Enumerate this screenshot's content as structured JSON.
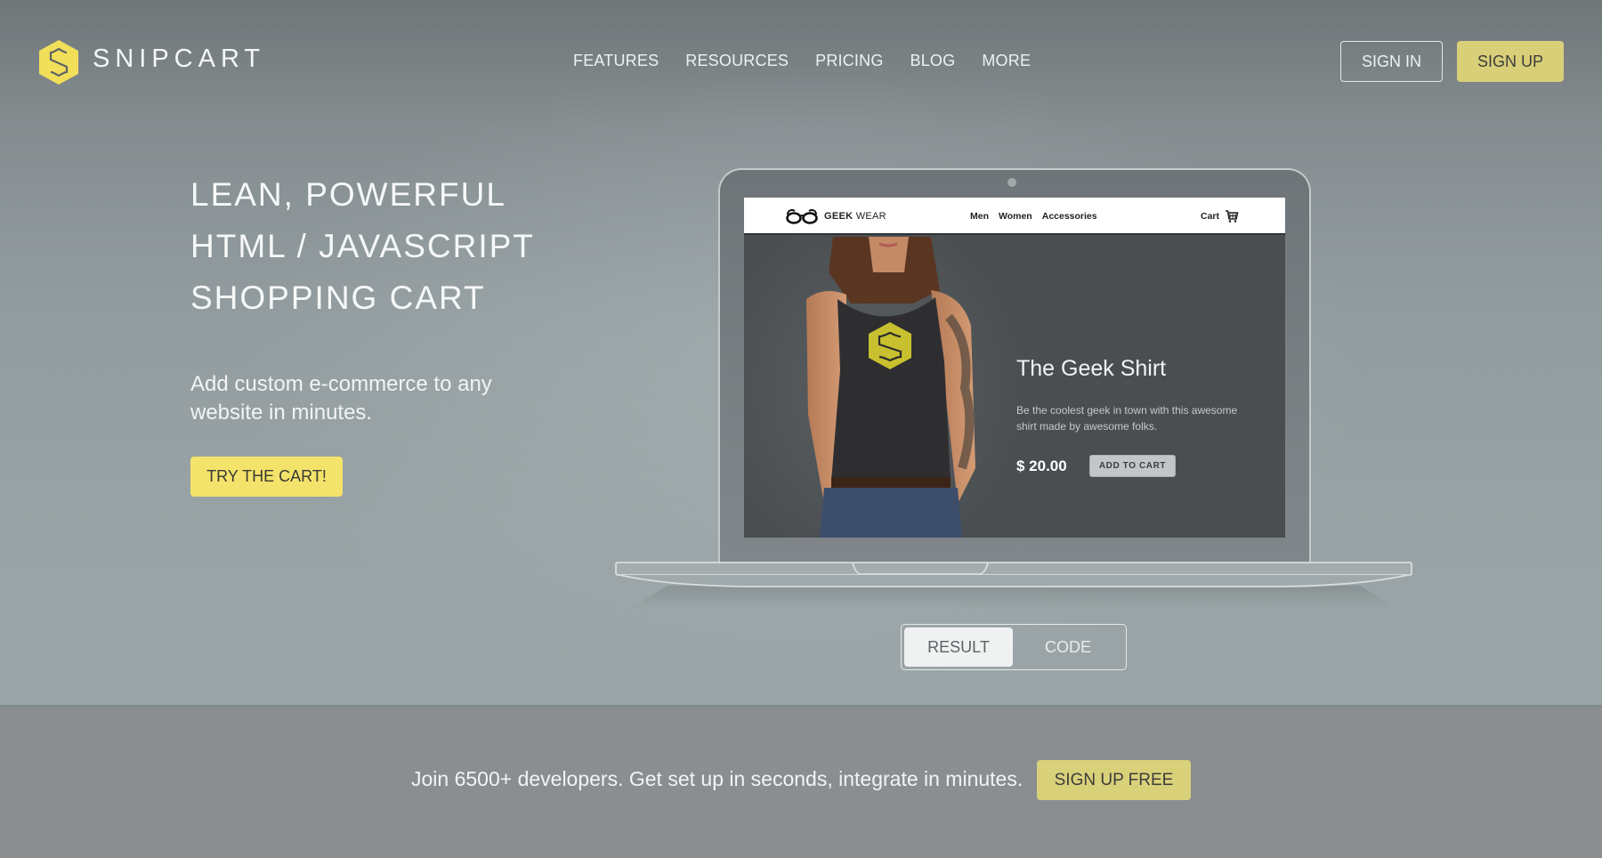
{
  "header": {
    "brand": "SNIPCART",
    "nav": [
      "FEATURES",
      "RESOURCES",
      "PRICING",
      "BLOG",
      "MORE"
    ],
    "sign_in": "SIGN IN",
    "sign_up": "SIGN UP"
  },
  "hero": {
    "headline": [
      "LEAN, POWERFUL",
      "HTML / JAVASCRIPT",
      "SHOPPING CART"
    ],
    "subline": "Add custom e-commerce to any website in minutes.",
    "cta": "TRY THE CART!"
  },
  "demo": {
    "site": {
      "brand_bold": "GEEK",
      "brand_rest": " WEAR",
      "links": [
        "Men",
        "Women",
        "Accessories"
      ],
      "cart_label": "Cart"
    },
    "product": {
      "title": "The Geek Shirt",
      "description": "Be the coolest geek in town with this awesome shirt made by awesome folks.",
      "price": "$ 20.00",
      "add_to_cart": "ADD TO CART"
    },
    "toggle": {
      "options": [
        "RESULT",
        "CODE"
      ],
      "selected": "RESULT"
    }
  },
  "cta_band": {
    "text": "Join 6500+ developers. Get set up in seconds, integrate in minutes.",
    "button": "SIGN UP FREE"
  },
  "colors": {
    "accent_yellow": "#f4e36a",
    "muted_yellow": "#d9cf78",
    "hero_bg": "#939da0",
    "footer_bg": "#8a8e90"
  }
}
